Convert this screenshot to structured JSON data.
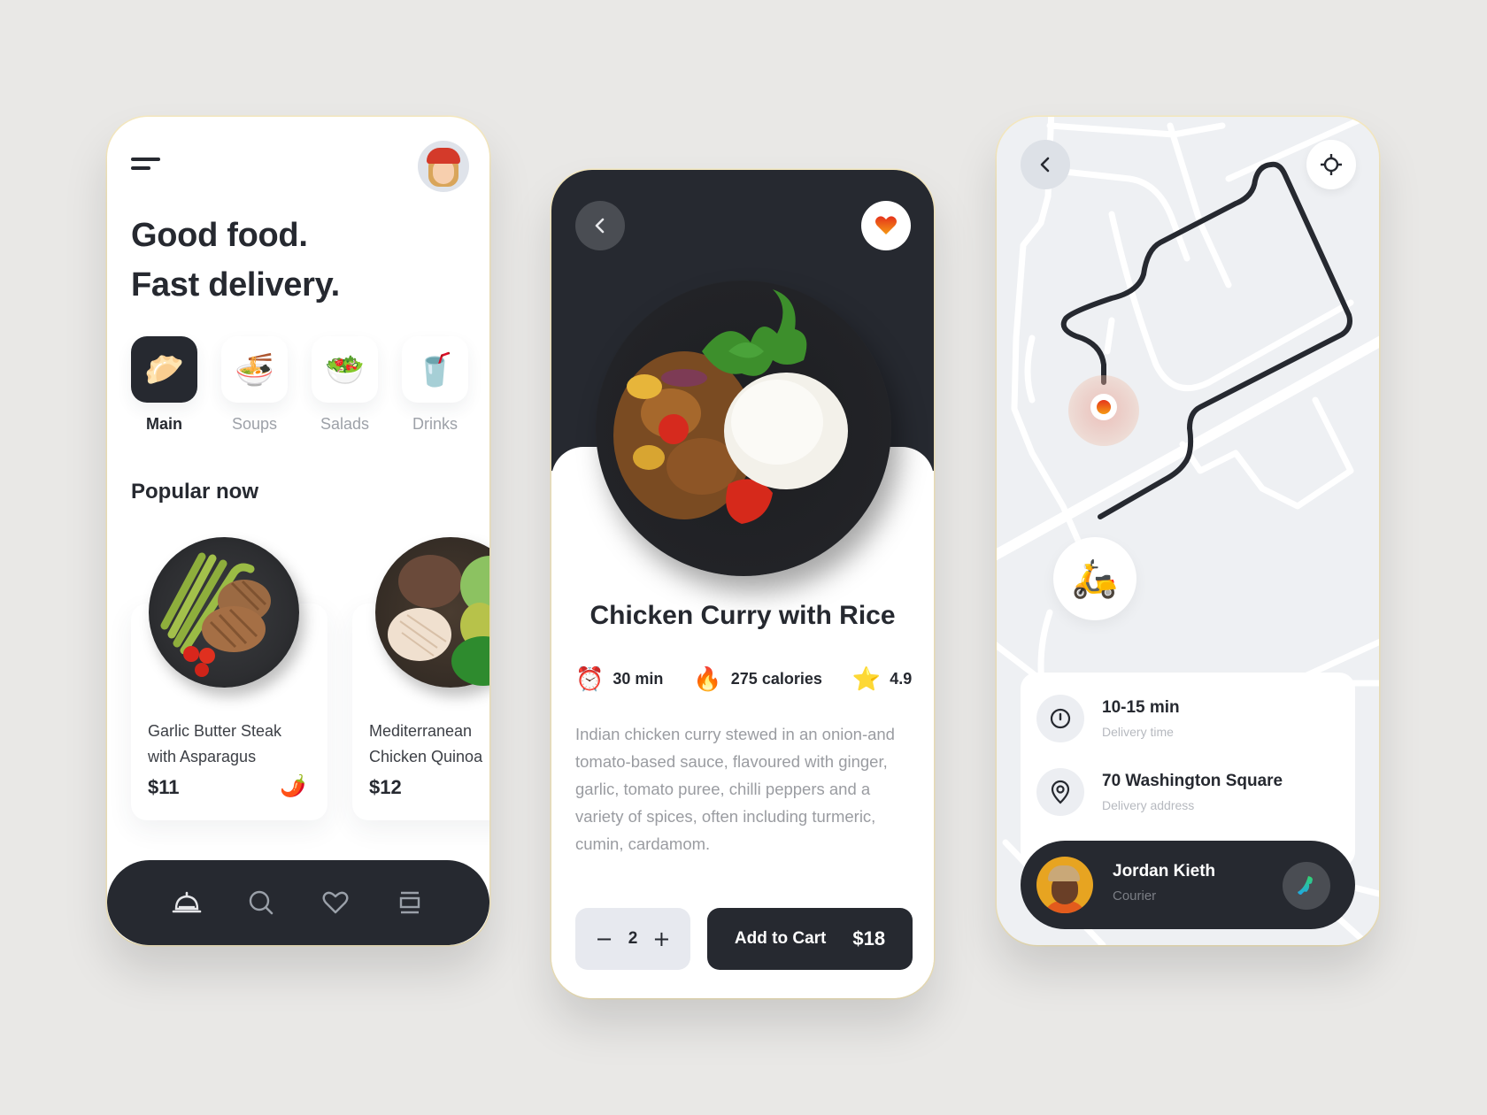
{
  "home": {
    "headline_line1": "Good food.",
    "headline_line2": "Fast delivery.",
    "categories": [
      {
        "label": "Main",
        "emoji": "🥟",
        "active": true
      },
      {
        "label": "Soups",
        "emoji": "🍜",
        "active": false
      },
      {
        "label": "Salads",
        "emoji": "🥗",
        "active": false
      },
      {
        "label": "Drinks",
        "emoji": "🥤",
        "active": false
      }
    ],
    "section_title": "Popular now",
    "popular": [
      {
        "name_line1": "Garlic Butter Steak",
        "name_line2": "with Asparagus",
        "price": "$11",
        "badge": "🌶️"
      },
      {
        "name_line1": "Mediterranean",
        "name_line2": "Chicken Quinoa",
        "price": "$12",
        "badge": ""
      }
    ],
    "nav": [
      "home-bell",
      "search",
      "favorites",
      "orders"
    ]
  },
  "detail": {
    "title": "Chicken Curry with Rice",
    "time_emoji": "⏰",
    "time": "30 min",
    "calories_emoji": "🔥",
    "calories": "275 calories",
    "rating_emoji": "⭐",
    "rating": "4.9",
    "description": "Indian chicken curry stewed in an onion-and tomato-based sauce, flavoured with ginger, garlic, tomato puree, chilli peppers and a variety of spices, often including turmeric, cumin, cardamom.",
    "quantity": "2",
    "minus": "−",
    "plus": "+",
    "add_to_cart": "Add to Cart",
    "total": "$18",
    "accent": "#f0501f"
  },
  "tracking": {
    "courier_emoji": "🛵",
    "eta": "10-15 min",
    "eta_label": "Delivery time",
    "address": "70 Washington Square",
    "address_label": "Delivery address",
    "courier_name": "Jordan Kieth",
    "courier_role": "Courier",
    "call_color": "#2bd18a"
  }
}
